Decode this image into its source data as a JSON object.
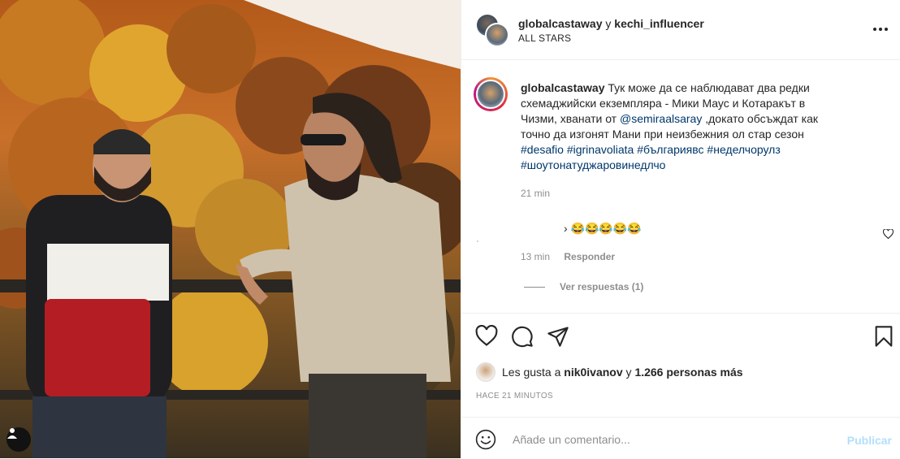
{
  "header": {
    "user1": "globalcastaway",
    "joiner": "y",
    "user2": "kechi_influencer",
    "subtitle": "ALL STARS"
  },
  "caption": {
    "username": "globalcastaway",
    "text_part1": " Тук може да се наблюдават два редки схемаджийски екземпляра - Мики Маус и Котаракът в Чизми, хванати от ",
    "mention": "@semiraalsaray",
    "text_part2": " ,докато обсъждат как точно да изгонят Мани при неизбежния ол стар сезон",
    "hashtag1": "#desafio",
    "hashtag2": "#igrinavoliata",
    "hashtag3": "#българиявс",
    "hashtag4": "#неделчорулз",
    "hashtag5": "#шоутонатуджаровинедлчо",
    "time": "21 min"
  },
  "reply": {
    "text": "› 😂😂😂😂😂",
    "time": "13 min",
    "respond_label": "Responder",
    "view_replies": "Ver respuestas (1)"
  },
  "likes": {
    "prefix": "Les gusta a",
    "user": "nik0ivanov",
    "joiner": "y",
    "count": "1.266 personas más"
  },
  "timestamp": "HACE 21 MINUTOS",
  "comment_box": {
    "placeholder": "Añade un comentario...",
    "publish_label": "Publicar"
  },
  "colors": {
    "link": "#00376b",
    "publish_disabled": "#b2dffc",
    "muted": "#8e8e8e"
  },
  "icons": [
    "more-icon",
    "heart-icon",
    "comment-icon",
    "share-icon",
    "bookmark-icon",
    "emoji-icon",
    "user-tag-icon"
  ]
}
